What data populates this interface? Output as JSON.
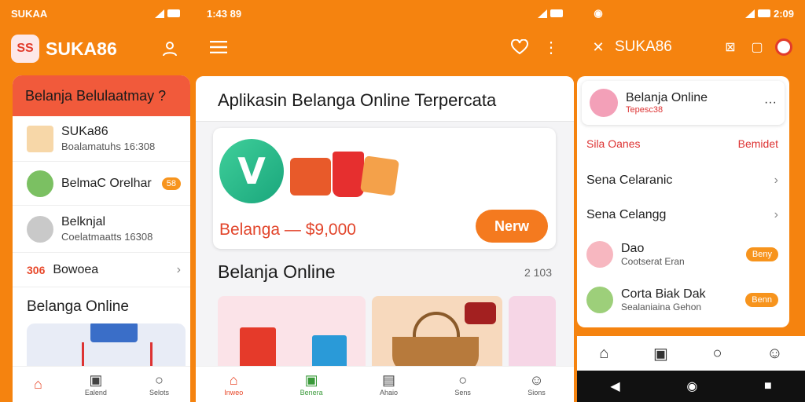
{
  "colors": {
    "accent": "#f5830f",
    "brand_red": "#e23b2b",
    "pill": "#f7941d"
  },
  "screen1": {
    "status_left": "SUKAA",
    "logo_text": "SS",
    "brand": "SUKA86",
    "banner": "Belanja Belulaatmay ?",
    "rows": [
      {
        "title": "SUKa86",
        "sub": "Boalamatuhs 16:308"
      },
      {
        "title": "BelmaC Orelhar",
        "badge": "58"
      },
      {
        "title": "Belknjal",
        "sub": "Coelatmaatts 16308"
      },
      {
        "title": "Bowoea",
        "prefix": "306"
      }
    ],
    "section": "Belanga Online",
    "nav": [
      {
        "icon": "home-icon",
        "label": ""
      },
      {
        "icon": "calendar-icon",
        "label": "Ealend"
      },
      {
        "icon": "search-icon",
        "label": "Selots"
      }
    ]
  },
  "screen2": {
    "status_left": "1:43 89",
    "title": "Aplikasin Belanga Online Terpercata",
    "featured_logo": "V",
    "featured_price": "Belanga — $9,000",
    "new_button": "Nerw",
    "section": "Belanja Online",
    "section_meta": "2 103",
    "nav": [
      {
        "icon": "home-icon",
        "label": "Inweo"
      },
      {
        "icon": "bag-icon",
        "label": "Benera"
      },
      {
        "icon": "cart-icon",
        "label": "Ahaio"
      },
      {
        "icon": "search-icon",
        "label": "Sens"
      },
      {
        "icon": "user-icon",
        "label": "Sions"
      }
    ]
  },
  "screen3": {
    "status_right": "2:09",
    "brand": "SUKA86",
    "card_title": "Belanja Online",
    "card_sub": "Tepesc38",
    "tab_left": "Sila Oanes",
    "tab_right": "Bemidet",
    "links": [
      "Sena Celaranic",
      "Sena Celangg"
    ],
    "items": [
      {
        "title": "Dao",
        "sub": "Cootserat Eran",
        "btn": "Beny"
      },
      {
        "title": "Corta Biak Dak",
        "sub": "Sealaniaina Gehon",
        "btn": "Benn"
      }
    ]
  }
}
